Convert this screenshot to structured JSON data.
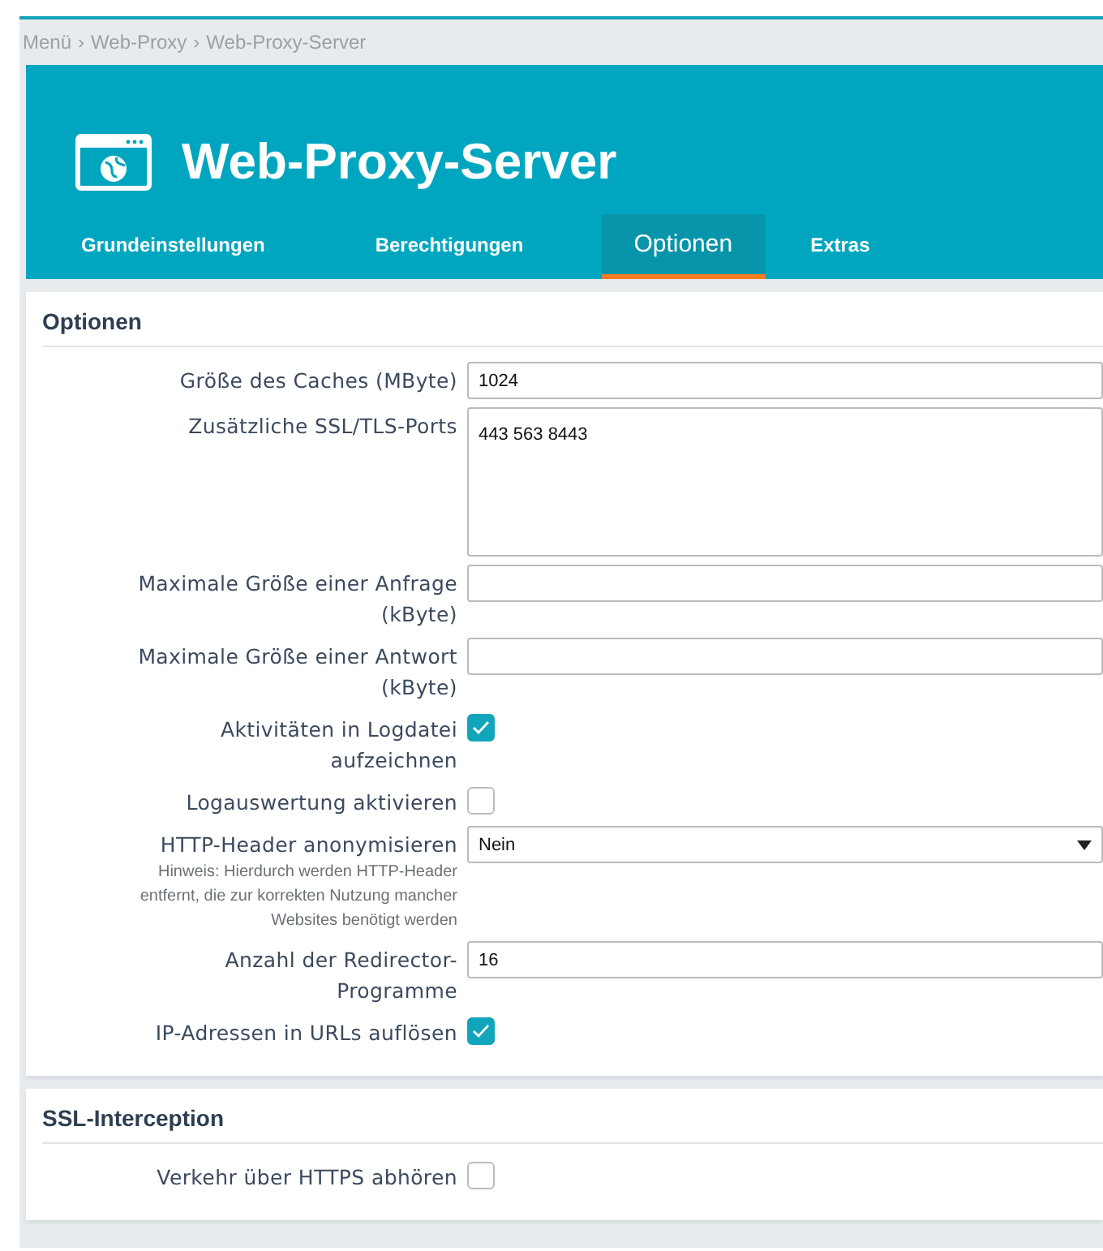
{
  "breadcrumb": [
    "Menü",
    "Web-Proxy",
    "Web-Proxy-Server"
  ],
  "breadcrumb_separator": "›",
  "header": {
    "title": "Web-Proxy-Server"
  },
  "tabs": [
    {
      "label": "Grundeinstellungen",
      "selected": false
    },
    {
      "label": "Berechtigungen",
      "selected": false
    },
    {
      "label": "Optionen",
      "selected": true
    },
    {
      "label": "Extras",
      "selected": false
    }
  ],
  "sections": [
    {
      "title": "Optionen",
      "fields": [
        {
          "kind": "text",
          "label": "Größe des Caches (MByte)",
          "value": "1024"
        },
        {
          "kind": "textarea",
          "label": "Zusätzliche SSL/TLS-Ports",
          "value": "443 563 8443"
        },
        {
          "kind": "text",
          "label": "Maximale Größe einer Anfrage (kByte)"
        },
        {
          "kind": "text",
          "label": "Maximale Größe einer Antwort (kByte)"
        },
        {
          "kind": "checkbox",
          "label": "Aktivitäten in Logdatei aufzeichnen",
          "checked": true
        },
        {
          "kind": "checkbox",
          "label": "Logauswertung aktivieren",
          "checked": false
        },
        {
          "kind": "select",
          "label": "HTTP-Header anonymisieren",
          "value": "Nein",
          "hint": "Hinweis: Hierdurch werden HTTP-Header entfernt, die zur korrekten Nutzung mancher Websites benötigt werden"
        },
        {
          "kind": "text",
          "label": "Anzahl der Redirector-Programme",
          "value": "16"
        },
        {
          "kind": "checkbox",
          "label": "IP-Adressen in URLs auflösen",
          "checked": true
        }
      ]
    },
    {
      "title": "SSL-Interception",
      "fields": [
        {
          "kind": "checkbox",
          "label": "Verkehr über HTTPS abhören",
          "checked": false
        }
      ]
    }
  ]
}
